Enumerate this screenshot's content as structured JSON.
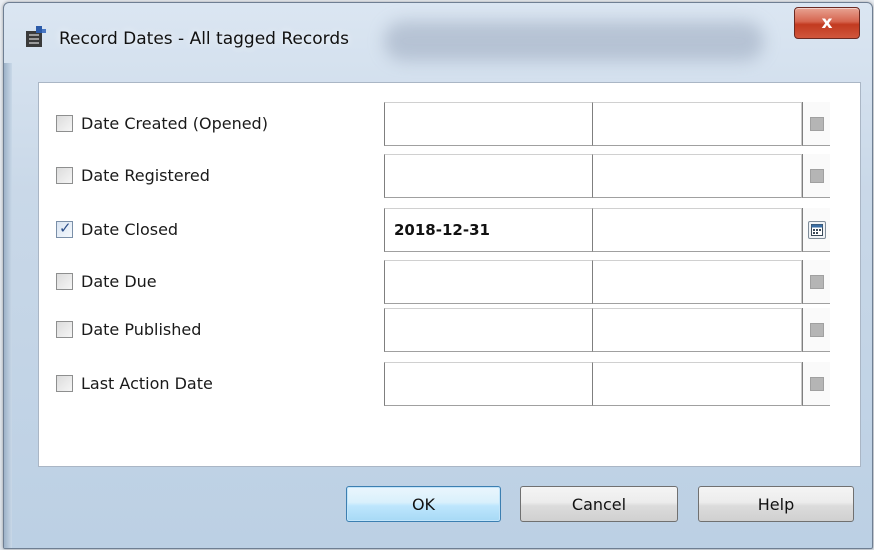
{
  "window": {
    "title": "Record Dates - All tagged Records",
    "close_glyph": "x"
  },
  "rows": [
    {
      "label": "Date Created (Opened)",
      "checked": false,
      "value": ""
    },
    {
      "label": "Date Registered",
      "checked": false,
      "value": ""
    },
    {
      "label": "Date Closed",
      "checked": true,
      "value": "2018-12-31"
    },
    {
      "label": "Date Due",
      "checked": false,
      "value": ""
    },
    {
      "label": "Date Published",
      "checked": false,
      "value": ""
    },
    {
      "label": "Last Action Date",
      "checked": false,
      "value": ""
    }
  ],
  "buttons": {
    "ok": "OK",
    "cancel": "Cancel",
    "help": "Help"
  },
  "icons": {
    "title": "record-dates-app-icon",
    "calendar": "calendar-icon",
    "check": "checkmark-icon"
  },
  "colors": {
    "default_button_border": "#3c7fb1",
    "close_button": "#c23a20",
    "checkmark": "#2c4f8a"
  }
}
